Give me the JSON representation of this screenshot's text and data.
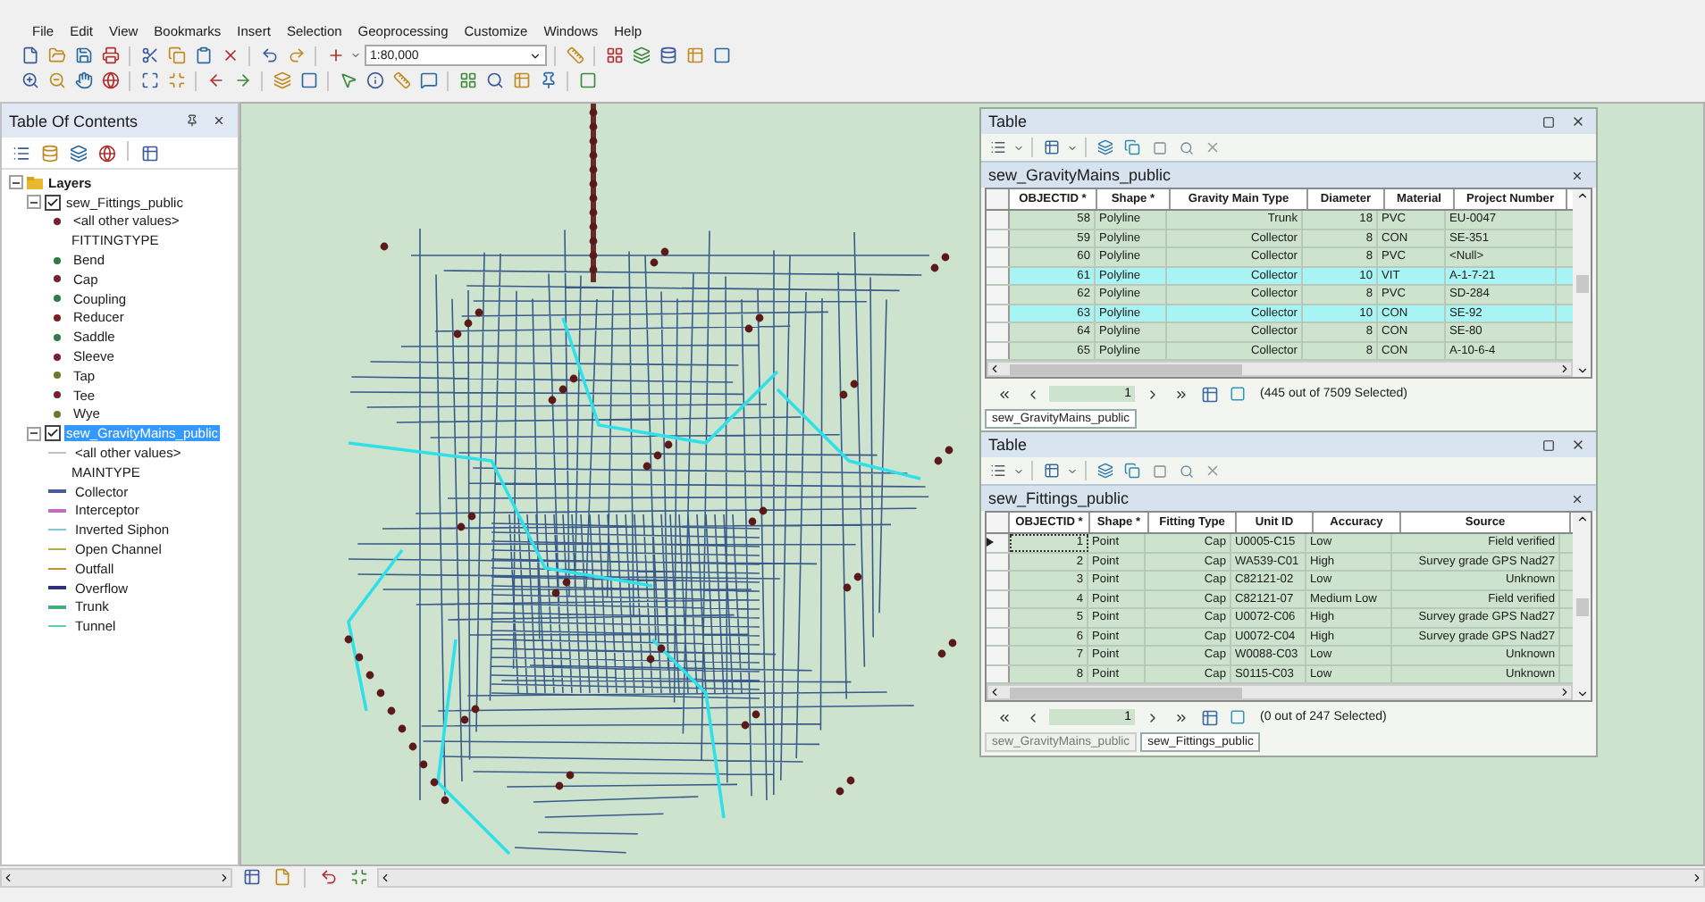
{
  "menu": [
    "File",
    "Edit",
    "View",
    "Bookmarks",
    "Insert",
    "Selection",
    "Geoprocessing",
    "Customize",
    "Windows",
    "Help"
  ],
  "scale": {
    "value": "1:80,000"
  },
  "toc": {
    "title": "Table Of Contents",
    "tree": [
      {
        "label": "Layers",
        "kind": "group",
        "expanded": true,
        "children": [
          {
            "label": "sew_Fittings_public",
            "kind": "layer",
            "checked": true,
            "selected": false,
            "expanded": true,
            "children": [
              {
                "label": "<all other values>",
                "kind": "point",
                "color": "#7a1f2a"
              },
              {
                "label": "FITTINGTYPE",
                "kind": "heading"
              },
              {
                "label": "Bend",
                "kind": "point",
                "color": "#2f7a4a"
              },
              {
                "label": "Cap",
                "kind": "point",
                "color": "#7a1f2a"
              },
              {
                "label": "Coupling",
                "kind": "point",
                "color": "#2f7a4a"
              },
              {
                "label": "Reducer",
                "kind": "point",
                "color": "#7a1f2a"
              },
              {
                "label": "Saddle",
                "kind": "point",
                "color": "#2f7a4a"
              },
              {
                "label": "Sleeve",
                "kind": "point",
                "color": "#7a1f2a"
              },
              {
                "label": "Tap",
                "kind": "point",
                "color": "#6a7a2a"
              },
              {
                "label": "Tee",
                "kind": "point",
                "color": "#7a1f2a"
              },
              {
                "label": "Wye",
                "kind": "point",
                "color": "#6a7a2a"
              }
            ]
          },
          {
            "label": "sew_GravityMains_public",
            "kind": "layer",
            "checked": true,
            "selected": true,
            "expanded": true,
            "children": [
              {
                "label": "<all other values>",
                "kind": "line",
                "color": "#b8c0c8"
              },
              {
                "label": "MAINTYPE",
                "kind": "heading"
              },
              {
                "label": "Collector",
                "kind": "line",
                "color": "#4a5a9a"
              },
              {
                "label": "Interceptor",
                "kind": "line",
                "color": "#c070c0"
              },
              {
                "label": "Inverted Siphon",
                "kind": "line",
                "color": "#80c8d8"
              },
              {
                "label": "Open Channel",
                "kind": "line",
                "color": "#b0b040"
              },
              {
                "label": "Outfall",
                "kind": "line",
                "color": "#d08a30"
              },
              {
                "label": "Overflow",
                "kind": "line",
                "color": "#303080"
              },
              {
                "label": "Trunk",
                "kind": "line",
                "color": "#40b080"
              },
              {
                "label": "Tunnel",
                "kind": "line",
                "color": "#60d0b0"
              }
            ]
          }
        ]
      }
    ]
  },
  "tables": [
    {
      "window_title": "Table",
      "title": "sew_GravityMains_public",
      "columns": [
        "OBJECTID *",
        "Shape *",
        "Gravity Main Type",
        "Diameter",
        "Material",
        "Project Number"
      ],
      "rows": [
        {
          "cells": [
            "58",
            "Polyline",
            "Trunk",
            "18",
            "PVC",
            "EU-0047"
          ],
          "selected": false,
          "current": false
        },
        {
          "cells": [
            "59",
            "Polyline",
            "Collector",
            "8",
            "CON",
            "SE-351"
          ],
          "selected": false,
          "current": false
        },
        {
          "cells": [
            "60",
            "Polyline",
            "Collector",
            "8",
            "PVC",
            "<Null>"
          ],
          "selected": false,
          "current": false
        },
        {
          "cells": [
            "61",
            "Polyline",
            "Collector",
            "10",
            "VIT",
            "A-1-7-21"
          ],
          "selected": true,
          "current": false
        },
        {
          "cells": [
            "62",
            "Polyline",
            "Collector",
            "8",
            "PVC",
            "SD-284"
          ],
          "selected": false,
          "current": false
        },
        {
          "cells": [
            "63",
            "Polyline",
            "Collector",
            "10",
            "CON",
            "SE-92"
          ],
          "selected": true,
          "current": false
        },
        {
          "cells": [
            "64",
            "Polyline",
            "Collector",
            "8",
            "CON",
            "SE-80"
          ],
          "selected": false,
          "current": false
        },
        {
          "cells": [
            "65",
            "Polyline",
            "Collector",
            "8",
            "CON",
            "A-10-6-4"
          ],
          "selected": false,
          "current": false
        }
      ],
      "record": "1",
      "status": "(445 out of 7509 Selected)",
      "tabs": [
        {
          "label": "sew_GravityMains_public",
          "selected": true
        }
      ]
    },
    {
      "window_title": "Table",
      "title": "sew_Fittings_public",
      "columns": [
        "OBJECTID *",
        "Shape *",
        "Fitting Type",
        "Unit ID",
        "Accuracy",
        "Source"
      ],
      "rows": [
        {
          "cells": [
            "1",
            "Point",
            "Cap",
            "U0005-C15",
            "Low",
            "Field verified"
          ],
          "selected": false,
          "current": true
        },
        {
          "cells": [
            "2",
            "Point",
            "Cap",
            "WA539-C01",
            "High",
            "Survey grade GPS Nad27"
          ],
          "selected": false,
          "current": false
        },
        {
          "cells": [
            "3",
            "Point",
            "Cap",
            "C82121-02",
            "Low",
            "Unknown"
          ],
          "selected": false,
          "current": false
        },
        {
          "cells": [
            "4",
            "Point",
            "Cap",
            "C82121-07",
            "Medium Low",
            "Field verified"
          ],
          "selected": false,
          "current": false
        },
        {
          "cells": [
            "5",
            "Point",
            "Cap",
            "U0072-C06",
            "High",
            "Survey grade GPS Nad27"
          ],
          "selected": false,
          "current": false
        },
        {
          "cells": [
            "6",
            "Point",
            "Cap",
            "U0072-C04",
            "High",
            "Survey grade GPS Nad27"
          ],
          "selected": false,
          "current": false
        },
        {
          "cells": [
            "7",
            "Point",
            "Cap",
            "W0088-C03",
            "Low",
            "Unknown"
          ],
          "selected": false,
          "current": false
        },
        {
          "cells": [
            "8",
            "Point",
            "Cap",
            "S0115-C03",
            "Low",
            "Unknown"
          ],
          "selected": false,
          "current": false
        }
      ],
      "record": "1",
      "status": "(0 out of 247 Selected)",
      "tabs": [
        {
          "label": "sew_GravityMains_public",
          "selected": false
        },
        {
          "label": "sew_Fittings_public",
          "selected": true
        }
      ]
    }
  ]
}
